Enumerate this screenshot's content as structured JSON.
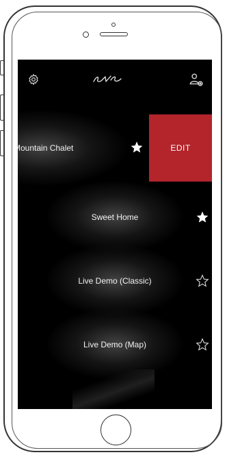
{
  "header": {
    "logo_text": "eve",
    "settings_icon": "gear-icon",
    "user_icon": "user-settings-icon"
  },
  "homes": [
    {
      "label": "Mountain Chalet",
      "favorite": true,
      "swiped": true
    },
    {
      "label": "Sweet Home",
      "favorite": true,
      "swiped": false
    },
    {
      "label": "Live Demo (Classic)",
      "favorite": false,
      "swiped": false
    },
    {
      "label": "Live Demo (Map)",
      "favorite": false,
      "swiped": false
    }
  ],
  "swipe_action": {
    "label": "EDIT",
    "color": "#b3252b"
  },
  "colors": {
    "background": "#000000",
    "text": "#f2f2f2",
    "accent": "#b3252b"
  }
}
